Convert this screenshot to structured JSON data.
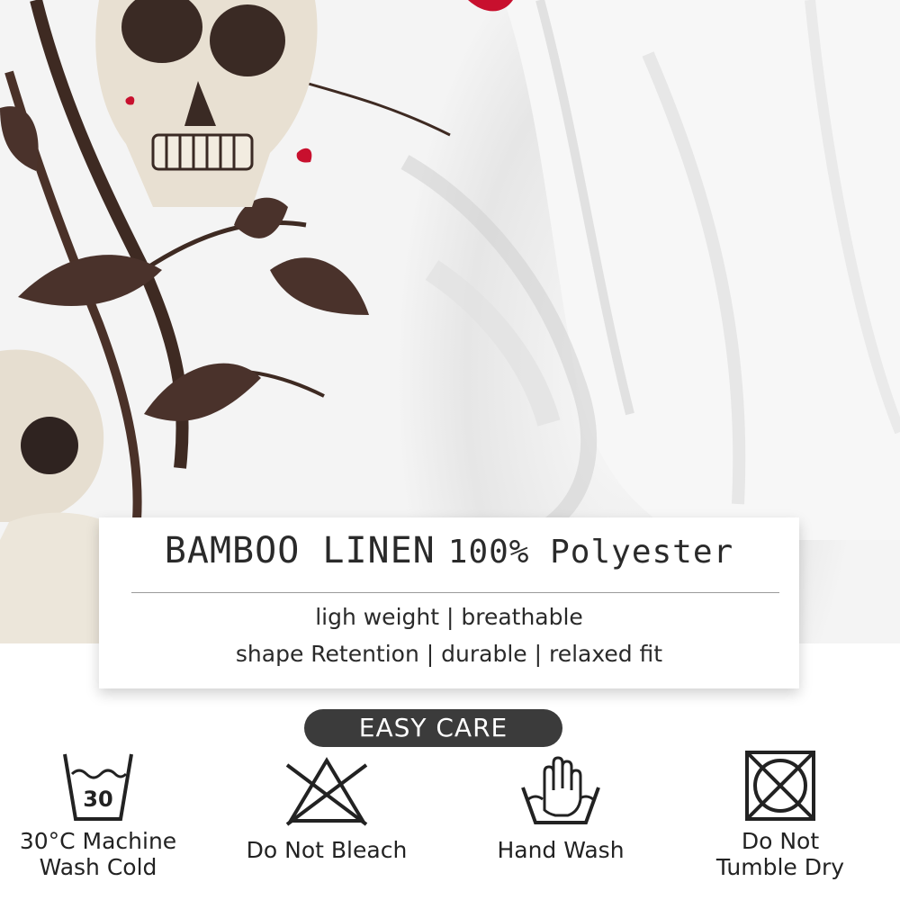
{
  "info_card": {
    "material": "BAMBOO LINEN",
    "composition": "100% Polyester",
    "features_line_1": "ligh weight | breathable",
    "features_line_2": "shape Retention | durable | relaxed fit"
  },
  "care": {
    "heading": "EASY CARE",
    "items": [
      {
        "icon": "washtub-30-icon",
        "icon_text": "30",
        "label_line_1": "30°C Machine",
        "label_line_2": "Wash Cold"
      },
      {
        "icon": "crossed-triangle-icon",
        "label_line_1": "Do Not Bleach"
      },
      {
        "icon": "hand-wash-icon",
        "label_line_1": "Hand Wash"
      },
      {
        "icon": "crossed-dryer-icon",
        "label_line_1": "Do Not",
        "label_line_2": "Tumble Dry"
      }
    ]
  },
  "colors": {
    "pill_background": "#3b3b3b",
    "text": "#2a2a2a",
    "accent_red": "#c8102e"
  }
}
